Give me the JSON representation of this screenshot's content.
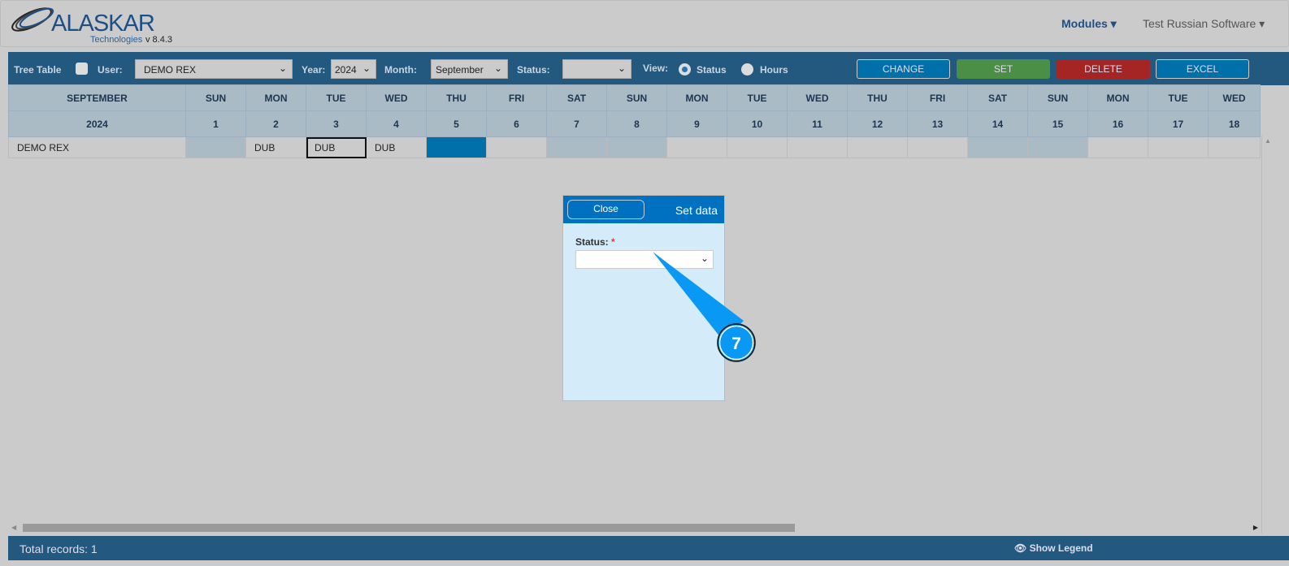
{
  "header": {
    "brand": "ALASKAR",
    "tagline": "Technologies",
    "version": "v 8.4.3",
    "modules": "Modules ▾",
    "user_menu": "Test Russian Software ▾"
  },
  "toolbar": {
    "tree_table": "Tree Table",
    "user_label": "User:",
    "user_value": "DEMO REX",
    "year_label": "Year:",
    "year_value": "2024",
    "month_label": "Month:",
    "month_value": "September",
    "status_label": "Status:",
    "status_value": "",
    "view_label": "View:",
    "view_status": "Status",
    "view_hours": "Hours",
    "view_selected": "Status",
    "change": "CHANGE",
    "set": "SET",
    "delete": "DELETE",
    "excel": "EXCEL"
  },
  "colors": {
    "change": "#0070aa",
    "set": "#4a8f45",
    "delete": "#a52524",
    "excel": "#0070aa",
    "selected_cell": "#0070aa"
  },
  "grid": {
    "month": "SEPTEMBER",
    "year": "2024",
    "days": [
      {
        "d": "SUN",
        "n": "1",
        "we": true
      },
      {
        "d": "MON",
        "n": "2"
      },
      {
        "d": "TUE",
        "n": "3"
      },
      {
        "d": "WED",
        "n": "4"
      },
      {
        "d": "THU",
        "n": "5"
      },
      {
        "d": "FRI",
        "n": "6"
      },
      {
        "d": "SAT",
        "n": "7",
        "we": true
      },
      {
        "d": "SUN",
        "n": "8",
        "we": true
      },
      {
        "d": "MON",
        "n": "9"
      },
      {
        "d": "TUE",
        "n": "10"
      },
      {
        "d": "WED",
        "n": "11"
      },
      {
        "d": "THU",
        "n": "12"
      },
      {
        "d": "FRI",
        "n": "13"
      },
      {
        "d": "SAT",
        "n": "14",
        "we": true
      },
      {
        "d": "SUN",
        "n": "15",
        "we": true
      },
      {
        "d": "MON",
        "n": "16"
      },
      {
        "d": "TUE",
        "n": "17"
      },
      {
        "d": "WED",
        "n": "18"
      }
    ],
    "rows": [
      {
        "name": "DEMO REX",
        "cells": [
          "",
          "DUB",
          "DUB",
          "DUB",
          "",
          "",
          "",
          "",
          "",
          "",
          "",
          "",
          "",
          "",
          "",
          "",
          "",
          ""
        ]
      }
    ]
  },
  "dialog": {
    "close": "Close",
    "title": "Set data",
    "status_label": "Status:",
    "required": "*",
    "status_value": ""
  },
  "callout": {
    "number": "7"
  },
  "footer": {
    "total": "Total records: 1",
    "legend": "Show Legend"
  }
}
